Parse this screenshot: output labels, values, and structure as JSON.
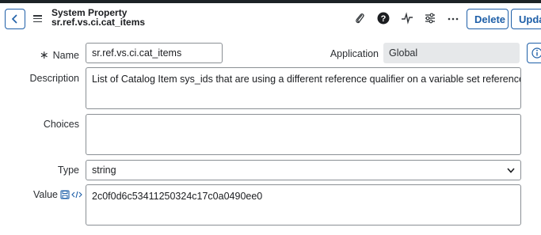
{
  "header": {
    "title_line1": "System Property",
    "title_line2": "sr.ref.vs.ci.cat_items",
    "delete_label": "Delete",
    "update_label": "Update",
    "icons": [
      "back-icon",
      "menu-icon",
      "paperclip-icon",
      "help-icon",
      "activity-icon",
      "settings-icon",
      "more-icon"
    ]
  },
  "form": {
    "required_mark": "∗",
    "name_label": "Name",
    "name_value": "sr.ref.vs.ci.cat_items",
    "application_label": "Application",
    "application_value": "Global",
    "description_label": "Description",
    "description_value": "List of Catalog Item sys_ids that are using a different reference qualifier on a variable set reference variable",
    "choices_label": "Choices",
    "choices_value": "",
    "type_label": "Type",
    "type_value": "string",
    "value_label": "Value",
    "value_value": "2c0f0d6c53411250324c17c0a0490ee0"
  },
  "colors": {
    "accent": "#1e5fa8",
    "top_stripe": "#1c2326",
    "readonly_bg": "#e6e8ea"
  }
}
